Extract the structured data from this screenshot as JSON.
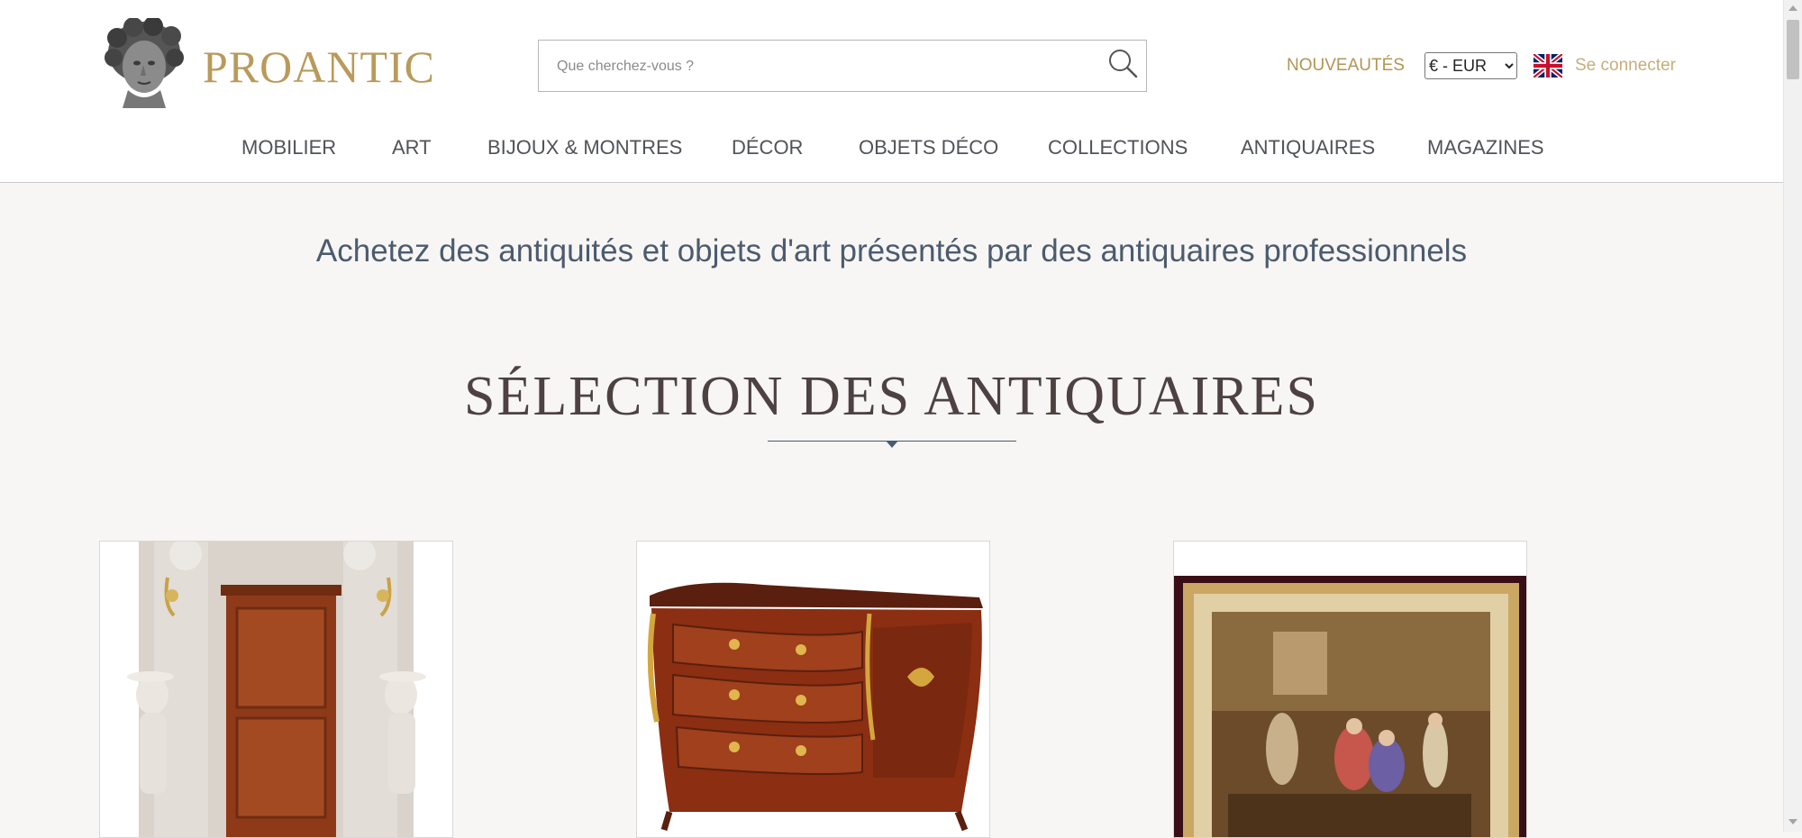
{
  "header": {
    "logo_text": "PROANTIC",
    "logo_icon": "classical-bust-icon",
    "search": {
      "placeholder": "Que cherchez-vous ?",
      "value": "",
      "icon": "search-icon"
    },
    "nouveautes_label": "NOUVEAUTÉS",
    "currency": {
      "selected": "€ - EUR",
      "options": [
        "€ - EUR"
      ]
    },
    "language_flag": "uk-flag-icon",
    "login_label": "Se connecter"
  },
  "nav": {
    "items": [
      {
        "label": "MOBILIER"
      },
      {
        "label": "ART"
      },
      {
        "label": "BIJOUX & MONTRES"
      },
      {
        "label": "DÉCOR"
      },
      {
        "label": "OBJETS DÉCO"
      },
      {
        "label": "COLLECTIONS"
      },
      {
        "label": "ANTIQUAIRES"
      },
      {
        "label": "MAGAZINES"
      }
    ]
  },
  "main": {
    "tagline": "Achetez des antiquités et objets d'art présentés par des antiquaires professionnels",
    "section_title": "SÉLECTION DES ANTIQUAIRES",
    "products": [
      {
        "image": "mahogany-cabinet-photo"
      },
      {
        "image": "louis-xv-commode-photo"
      },
      {
        "image": "gilt-framed-painting-photo"
      }
    ]
  },
  "colors": {
    "brand_gold": "#b99a5b",
    "nav_text": "#505358",
    "tagline_blue": "#4c5b6e",
    "title_brown": "#4d4241",
    "page_bg": "#f7f6f4"
  }
}
